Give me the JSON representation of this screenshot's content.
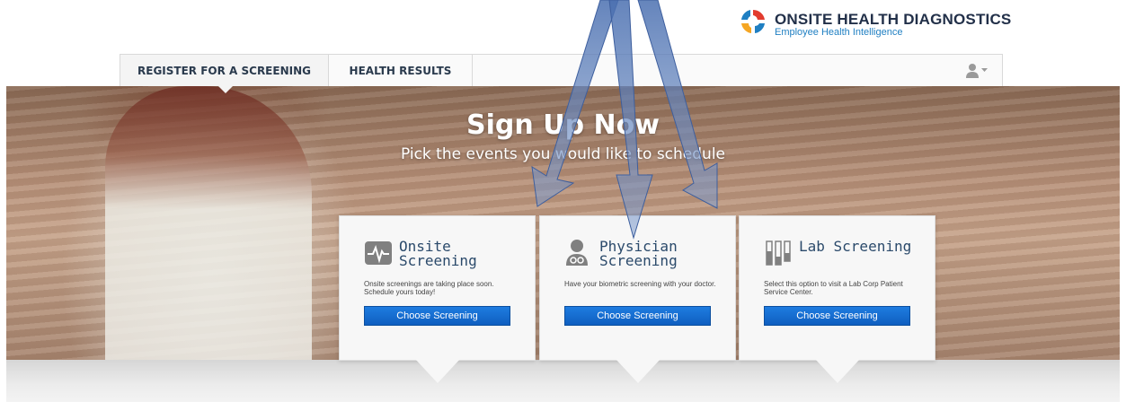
{
  "brand": {
    "name": "ONSITE HEALTH DIAGNOSTICS",
    "tagline": "Employee Health Intelligence",
    "colors": {
      "blue": "#1f7fc2",
      "red": "#e23b2e",
      "orange": "#f5a623",
      "dark": "#223049"
    }
  },
  "nav": {
    "tabs": [
      {
        "label": "REGISTER FOR A SCREENING",
        "active": true
      },
      {
        "label": "HEALTH RESULTS",
        "active": false
      }
    ],
    "user_menu_icon": "user-icon"
  },
  "hero": {
    "title": "Sign Up Now",
    "subtitle": "Pick the events you would like to schedule"
  },
  "cards": [
    {
      "icon": "heartbeat-icon",
      "title": "Onsite Screening",
      "description": "Onsite screenings are taking place soon. Schedule yours today!",
      "button": "Choose Screening"
    },
    {
      "icon": "doctor-icon",
      "title": "Physician Screening",
      "description": "Have your biometric screening with your doctor.",
      "button": "Choose Screening"
    },
    {
      "icon": "test-tubes-icon",
      "title": "Lab Screening",
      "description": "Select this option to visit a Lab Corp Patient Service Center.",
      "button": "Choose Screening"
    }
  ],
  "theme": {
    "accent": "#1669d6",
    "nav_text": "#2a3a4d",
    "card_title": "#2b4a6b"
  }
}
